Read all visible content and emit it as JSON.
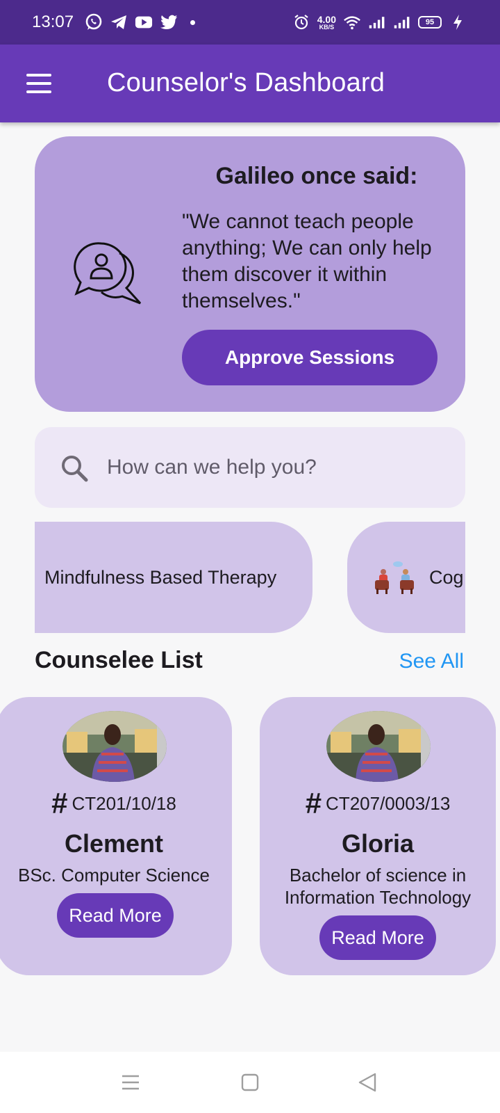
{
  "status_bar": {
    "time": "13:07",
    "apps": [
      "whatsapp-icon",
      "telegram-icon",
      "youtube-icon",
      "twitter-icon"
    ],
    "net_speed": "4.00",
    "net_unit": "KB/S",
    "battery": "95"
  },
  "app_bar": {
    "title": "Counselor's Dashboard"
  },
  "quote_card": {
    "heading": "Galileo once said:",
    "quote": "\"We cannot teach people anything; We can only help them discover it within themselves.\"",
    "button_label": "Approve Sessions"
  },
  "search": {
    "placeholder": "How can we help you?"
  },
  "categories": [
    {
      "label": "Mindfulness Based Therapy"
    },
    {
      "label": "Cog"
    }
  ],
  "counselee_list": {
    "title": "Counselee List",
    "see_all": "See All",
    "items": [
      {
        "reg_no": "CT201/10/18",
        "name": "Clement",
        "course": "BSc.  Computer Science",
        "button": "Read More"
      },
      {
        "reg_no": "CT207/0003/13",
        "name": "Gloria",
        "course": "Bachelor of science in Information Technology",
        "button": "Read More"
      }
    ]
  },
  "colors": {
    "status_bar": "#4c2a8c",
    "primary": "#673ab7",
    "quote_card": "#b39ddb",
    "card": "#d1c4e9",
    "search_bg": "#ede7f6",
    "link": "#2196f3"
  }
}
